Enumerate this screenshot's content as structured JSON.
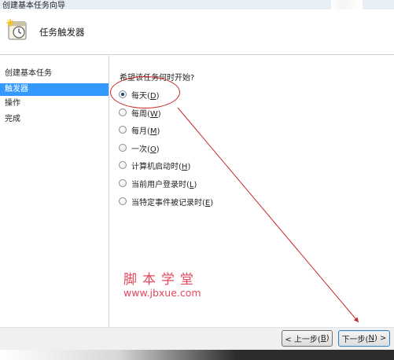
{
  "window": {
    "title": "创建基本任务向导"
  },
  "header": {
    "title": "任务触发器",
    "icon": "clock-icon"
  },
  "sidebar": {
    "items": [
      {
        "label": "创建基本任务",
        "active": false
      },
      {
        "label": "触发器",
        "active": true
      },
      {
        "label": "操作",
        "active": false
      },
      {
        "label": "完成",
        "active": false
      }
    ]
  },
  "main": {
    "question": "希望该任务何时开始?",
    "options": [
      {
        "text": "每天",
        "key": "D",
        "checked": true
      },
      {
        "text": "每周",
        "key": "W",
        "checked": false
      },
      {
        "text": "每月",
        "key": "M",
        "checked": false
      },
      {
        "text": "一次",
        "key": "O",
        "checked": false
      },
      {
        "text": "计算机启动时",
        "key": "H",
        "checked": false
      },
      {
        "text": "当前用户登录时",
        "key": "L",
        "checked": false
      },
      {
        "text": "当特定事件被记录时",
        "key": "E",
        "checked": false
      }
    ]
  },
  "watermark": {
    "site_name": "脚本学堂",
    "url": "www.jbxue.com"
  },
  "footer": {
    "back": {
      "text": "< 上一步(",
      "key": "B",
      "end": ")"
    },
    "next": {
      "text": "下一步(",
      "key": "N",
      "end": ") >"
    }
  },
  "colors": {
    "annotation": "#c8282a",
    "selection": "#3399ff",
    "watermark": "#e4475d"
  }
}
